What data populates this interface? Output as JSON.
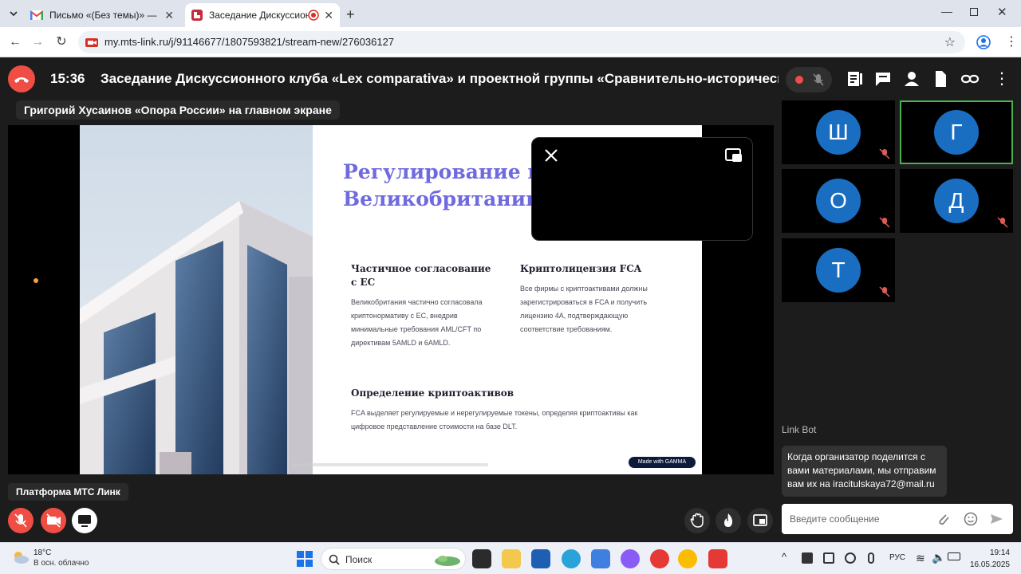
{
  "browser": {
    "tabs": [
      {
        "title": "Письмо «(Без темы)» — Шерш"
      },
      {
        "title": "Заседание Дискуссионног"
      }
    ],
    "url": "my.mts-link.ru/j/91146677/1807593821/stream-new/276036127"
  },
  "meeting": {
    "time": "15:36",
    "title": "Заседание Дискуссионного клуба «Lex comparativa» и проектной группы «Сравнительно-историческое",
    "main_screen_label": "Григорий Хусаинов «Опора России» на главном экране",
    "platform_label": "Платформа МТС Линк"
  },
  "slide": {
    "title_line1": "Регулирование кр",
    "title_line2": "Великобритании",
    "sections": [
      {
        "heading": "Частичное согласование с ЕС",
        "body": "Великобритания частично согласовала криптонормативу с ЕС, внедрив минимальные требования AML/CFT по директивам 5AMLD и 6AMLD."
      },
      {
        "heading": "Криптолицензия FCA",
        "body": "Все фирмы с криптоактивами должны зарегистрироваться в FCA и получить лицензию 4A, подтверждающую соответствие требованиям."
      },
      {
        "heading": "Определение криптоактивов",
        "body": "FCA выделяет регулируемые и нерегулируемые токены, определяя криптоактивы как цифровое представление стоимости на базе DLT."
      }
    ],
    "badge": "Made with GAMMA",
    "progress_fraction": 0.1
  },
  "participants": [
    {
      "initial": "Ш",
      "muted": true,
      "active": false
    },
    {
      "initial": "Г",
      "muted": false,
      "active": true
    },
    {
      "initial": "О",
      "muted": true,
      "active": false
    },
    {
      "initial": "Д",
      "muted": true,
      "active": false
    },
    {
      "initial": "Т",
      "muted": true,
      "active": false
    }
  ],
  "chat": {
    "sender": "Link Bot",
    "message": "Когда организатор поделится с вами материалами, мы отправим вам их на iracitulskaya72@mail.ru",
    "input_placeholder": "Введите сообщение"
  },
  "taskbar": {
    "temperature": "18°C",
    "weather": "В осн. облачно",
    "search_label": "Поиск",
    "language": "РУС",
    "time": "19:14",
    "date": "16.05.2025"
  },
  "colors": {
    "accent_red": "#f04e45",
    "avatar_blue": "#1a6ec2",
    "active_border": "#4caf50",
    "slide_title": "#6f6adf"
  }
}
